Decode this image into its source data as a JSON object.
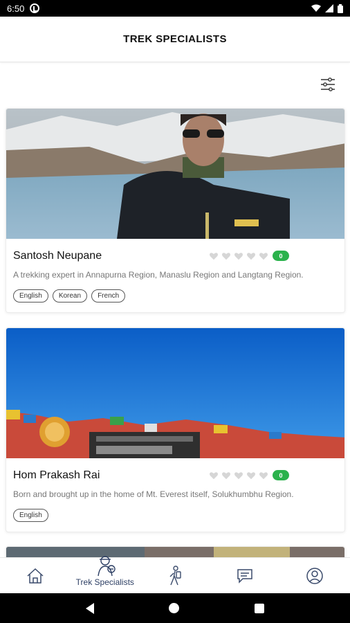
{
  "status_bar": {
    "time": "6:50",
    "icons": [
      "notification-icon",
      "wifi-icon",
      "signal-icon",
      "battery-icon"
    ]
  },
  "header": {
    "title": "TREK SPECIALISTS"
  },
  "filter": {
    "icon": "filter-sliders-icon"
  },
  "specialists": [
    {
      "name": "Santosh Neupane",
      "rating_count": "0",
      "description": "A trekking expert in Annapurna Region, Manaslu Region and Langtang Region.",
      "languages": [
        "English",
        "Korean",
        "French"
      ]
    },
    {
      "name": "Hom Prakash Rai",
      "rating_count": "0",
      "description": "Born and brought up in the home of Mt. Everest itself, Solukhumbhu Region.",
      "languages": [
        "English"
      ]
    }
  ],
  "bottom_nav": {
    "items": [
      {
        "id": "home",
        "icon": "home-icon",
        "label": ""
      },
      {
        "id": "trek-specialists",
        "icon": "trekker-icon",
        "label": "Trek Specialists"
      },
      {
        "id": "guide",
        "icon": "hiker-icon",
        "label": ""
      },
      {
        "id": "messages",
        "icon": "chat-icon",
        "label": ""
      },
      {
        "id": "profile",
        "icon": "profile-icon",
        "label": ""
      }
    ]
  },
  "colors": {
    "accent": "#2d3f64",
    "badge": "#2bb24c",
    "heart": "#d6d6d6"
  }
}
